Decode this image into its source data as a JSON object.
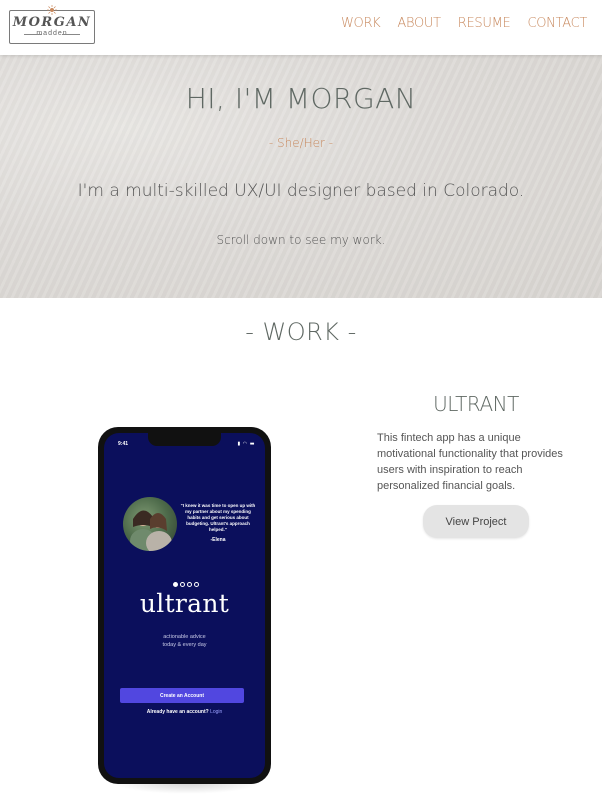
{
  "nav": {
    "logo": {
      "main": "MORGAN",
      "sub": "madden"
    },
    "links": [
      "WORK",
      "ABOUT",
      "RESUME",
      "CONTACT"
    ]
  },
  "hero": {
    "title": "HI, I'M MORGAN",
    "pronouns": "- She/Her -",
    "description": "I'm a multi-skilled UX/UI designer based in Colorado.",
    "scroll_hint": "Scroll down to see my work."
  },
  "work": {
    "heading": "- WORK -",
    "project": {
      "title": "ULTRANT",
      "description": "This fintech app has a unique motivational functionality that provides users with inspiration to reach personalized financial goals.",
      "button_label": "View Project"
    }
  },
  "phone": {
    "status_time": "9:41",
    "quote": "\"I knew it was time to open up with my partner about my spending habits and get serious about budgeting. Ultrant's approach helped.\"",
    "quote_author": "-Elena",
    "app_name": "ultrant",
    "tagline_line1": "actionable advice",
    "tagline_line2": "today & every day",
    "create_button": "Create an Account",
    "login_prompt": "Already have an account?",
    "login_link": "Login",
    "carousel_total": 4,
    "carousel_active": 1
  },
  "colors": {
    "accent": "#c8895e",
    "heading": "#5f6863",
    "app_bg": "#0b0f5c",
    "app_button": "#5147e0"
  }
}
